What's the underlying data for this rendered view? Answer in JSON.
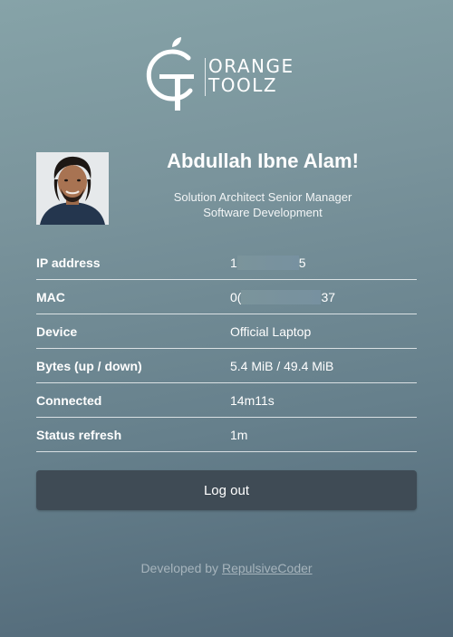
{
  "brand": {
    "line1": "ORANGE",
    "line2": "TOOLZ",
    "icon": "orange-toolz-logo"
  },
  "user": {
    "name": "Abdullah Ibne Alam!",
    "role_line1": "Solution Architect Senior Manager",
    "role_line2": "Software Development",
    "avatar_icon": "user-avatar-photo"
  },
  "info": {
    "ip": {
      "label": "IP address",
      "value_start": "1",
      "value_end": "5"
    },
    "mac": {
      "label": "MAC",
      "value_start": "0(",
      "value_end": "37"
    },
    "device": {
      "label": "Device",
      "value": "Official Laptop"
    },
    "bytes": {
      "label": "Bytes (up / down)",
      "value": "5.4 MiB / 49.4 MiB"
    },
    "connected": {
      "label": "Connected",
      "value": "14m11s"
    },
    "refresh": {
      "label": "Status refresh",
      "value": "1m"
    }
  },
  "actions": {
    "logout_label": "Log out"
  },
  "footer": {
    "prefix": "Developed by",
    "author": "RepulsiveCoder"
  },
  "colors": {
    "background_top": "#86a3a8",
    "background_bottom": "#4f6676",
    "button": "#3f4b55",
    "footer_text": "#a6b4bc"
  }
}
